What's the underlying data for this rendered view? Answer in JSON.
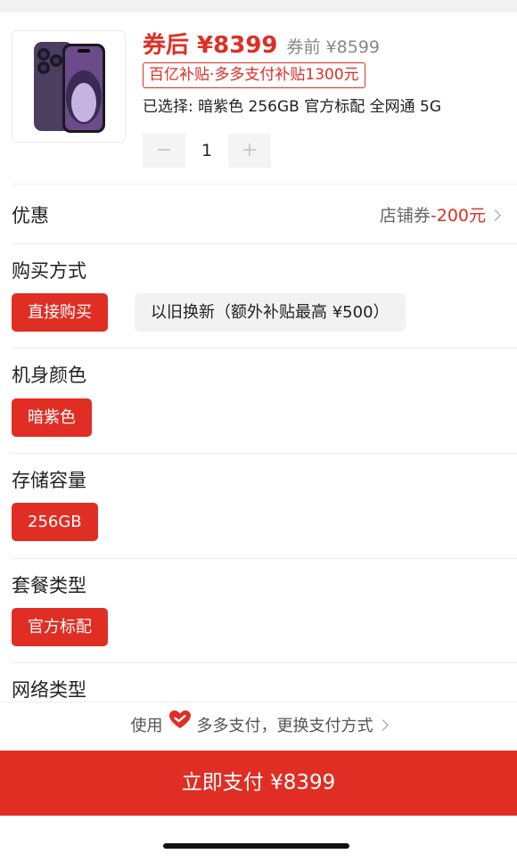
{
  "product": {
    "price_after_label": "券后 ¥8399",
    "price_before_label": "券前 ¥8599",
    "subsidy_badge": "百亿补贴·多多支付补贴1300元",
    "selected_label": "已选择: 暗紫色 256GB 官方标配 全网通 5G",
    "quantity": "1",
    "minus_label": "−",
    "plus_label": "+"
  },
  "discount": {
    "title": "优惠",
    "store_coupon_label": "店铺券",
    "store_coupon_amount": "-200元"
  },
  "purchase_method": {
    "title": "购买方式",
    "options": [
      "直接购买",
      "以旧换新（额外补贴最高 ¥500）"
    ],
    "selected": "直接购买"
  },
  "color": {
    "title": "机身颜色",
    "options": [
      "暗紫色"
    ],
    "selected": "暗紫色"
  },
  "storage": {
    "title": "存储容量",
    "options": [
      "256GB"
    ],
    "selected": "256GB"
  },
  "package": {
    "title": "套餐类型",
    "options": [
      "官方标配"
    ],
    "selected": "官方标配"
  },
  "network": {
    "title": "网络类型"
  },
  "payment": {
    "use_label": "使用",
    "method_label": "多多支付，更换支付方式",
    "pay_button_label": "立即支付 ¥8399"
  },
  "colors": {
    "accent": "#e02e24",
    "phone_body": "#4b3e5e"
  },
  "icons": {
    "thumbnail": "phone-product-image",
    "heart": "heart-icon",
    "chevron": "chevron-right-icon"
  }
}
